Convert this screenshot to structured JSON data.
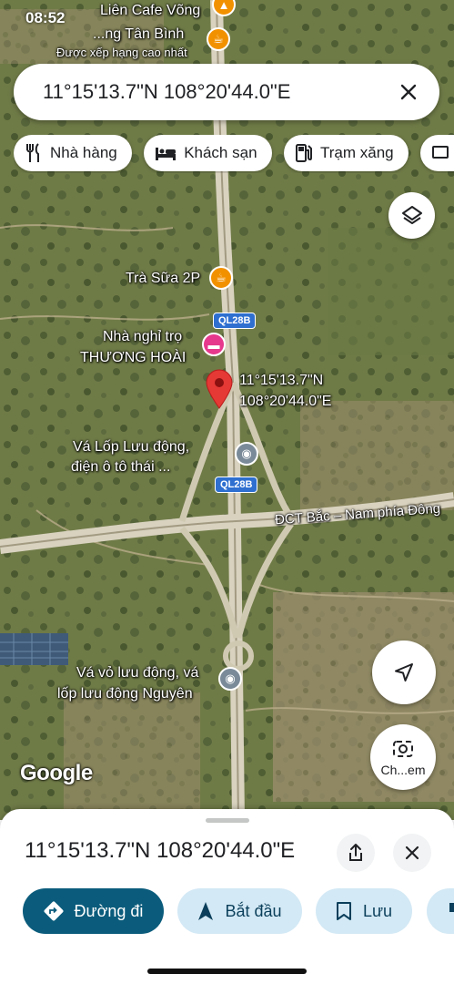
{
  "status": {
    "time": "08:52"
  },
  "search": {
    "query": "11°15'13.7\"N 108°20'44.0\"E",
    "close_icon": "close-icon"
  },
  "chips": [
    {
      "label": "Nhà hàng",
      "icon": "restaurant-icon"
    },
    {
      "label": "Khách sạn",
      "icon": "hotel-icon"
    },
    {
      "label": "Trạm xăng",
      "icon": "gas-station-icon"
    }
  ],
  "map": {
    "pois": {
      "top_cafe_1": "Liên Cafe Võng",
      "top_cafe_2": "...ng Tân Bình",
      "top_cafe_3": "Được xếp hạng cao nhất",
      "tra_sua": "Trà Sữa 2P",
      "nha_nghi_1": "Nhà nghỉ trọ",
      "nha_nghi_2": "THƯƠNG HOÀI",
      "vo_lop_1": "Vá Lốp Lưu động,",
      "vo_lop_2": "điện ô tô thái ...",
      "va_vo_1": "Vá vỏ lưu động, vá",
      "va_vo_2": "lốp lưu động Nguyên",
      "pin_label_1": "11°15'13.7\"N",
      "pin_label_2": "108°20'44.0\"E"
    },
    "roads": {
      "ql_north": "QL28B",
      "ql_south": "QL28B",
      "expressway": "ĐCT Bắc – Nam phía Đông"
    },
    "google_logo": "Google",
    "colors": {
      "pin": "#e53935",
      "cafe": "#f29100",
      "hotel": "#e6388c",
      "service": "#7a8a99"
    }
  },
  "controls": {
    "layers_icon": "layers-icon",
    "locate_icon": "navigation-arrow-icon",
    "search_image_label": "Ch...em"
  },
  "sheet": {
    "title": "11°15'13.7\"N 108°20'44.0\"E",
    "actions": [
      {
        "label": "Đường đi",
        "icon": "directions-icon",
        "primary": true
      },
      {
        "label": "Bắt đầu",
        "icon": "navigation-icon",
        "primary": false
      },
      {
        "label": "Lưu",
        "icon": "bookmark-icon",
        "primary": false
      },
      {
        "label": "",
        "icon": "flag-icon",
        "primary": false
      }
    ]
  }
}
